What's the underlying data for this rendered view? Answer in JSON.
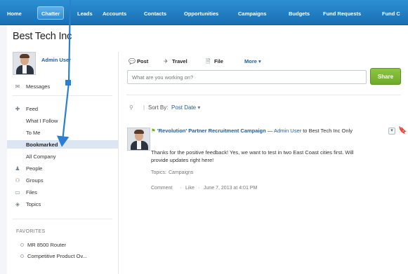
{
  "nav": {
    "tabs": [
      "Home",
      "Chatter",
      "Leads",
      "Accounts",
      "Contacts",
      "Opportunities",
      "Campaigns",
      "Budgets",
      "Fund Requests",
      "Fund C"
    ],
    "active_index": 1
  },
  "page": {
    "title": "Best Tech Inc"
  },
  "sidebar": {
    "user_name": "Admin User",
    "messages": "Messages",
    "feed": "Feed",
    "feed_items": [
      "What I Follow",
      "To Me",
      "Bookmarked",
      "All Company"
    ],
    "selected_feed_item": "Bookmarked",
    "nav_items": [
      {
        "label": "People",
        "icon": "people-icon"
      },
      {
        "label": "Groups",
        "icon": "groups-icon"
      },
      {
        "label": "Files",
        "icon": "files-icon"
      },
      {
        "label": "Topics",
        "icon": "topics-icon"
      }
    ],
    "favorites_header": "FAVORITES",
    "favorites": [
      "MR 8500 Router",
      "Competitive Product Ov..."
    ]
  },
  "publisher": {
    "tabs": [
      {
        "label": "Post",
        "icon": "post-icon"
      },
      {
        "label": "Travel",
        "icon": "travel-icon"
      },
      {
        "label": "File",
        "icon": "file-icon"
      },
      {
        "label": "More",
        "icon": "chevron-down-icon"
      }
    ],
    "placeholder": "What are you working on?",
    "share_label": "Share"
  },
  "feed_controls": {
    "sort_label": "Sort By:",
    "sort_value": "Post Date"
  },
  "post": {
    "campaign": "'Revolution' Partner Recruitment Campaign",
    "separator": "—",
    "author": "Admin User",
    "to_text": "to",
    "group": "Best Tech Inc Only",
    "body": "Thanks for the positive feedback! Yes, we want to test in two East Coast cities first. Will provide updates right here!",
    "topics_label": "Topics:",
    "topics": "Campaigns",
    "actions": {
      "comment": "Comment",
      "like": "Like",
      "timestamp": "June 7, 2013 at 4:01 PM"
    }
  },
  "colors": {
    "nav_blue": "#1a6fb3",
    "link_blue": "#1f5fa0",
    "share_green": "#76b02f",
    "annotation_arrow": "#2c7fd0",
    "bookmarked_highlight": "#dbe6f2"
  }
}
